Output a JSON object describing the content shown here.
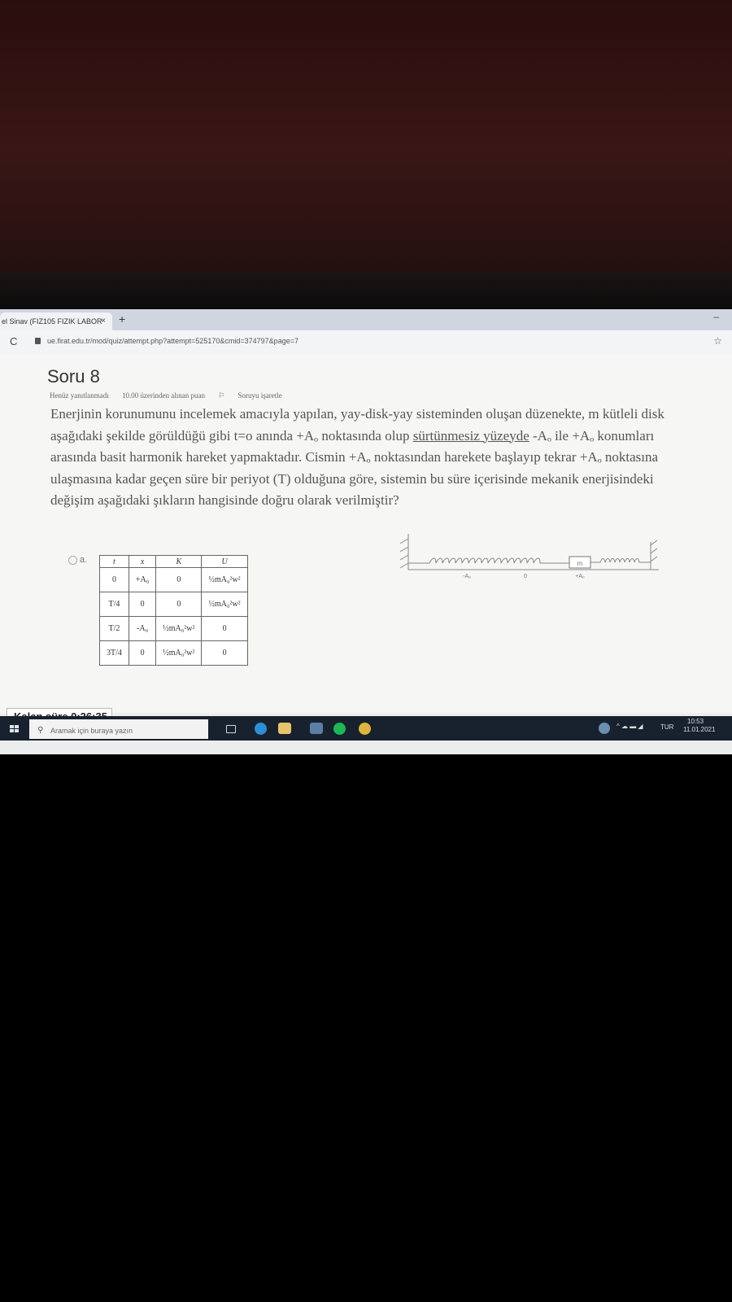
{
  "browser": {
    "tab_title": "el Sinav (FIZ105 FIZIK LABOR",
    "tab_close": "×",
    "new_tab": "+",
    "minimize": "–",
    "reload": "C",
    "url": "ue.firat.edu.tr/mod/quiz/attempt.php?attempt=525170&cmid=374797&page=7",
    "star": "☆"
  },
  "question": {
    "title": "Soru 8",
    "status": "Henüz yanıtlanmadı",
    "points": "10.00 üzerinden alınan puan",
    "flag": "Soruyu işaretle",
    "text_before": "Enerjinin korunumunu incelemek amacıyla yapılan, yay-disk-yay sisteminden oluşan düzenekte, m kütleli disk aşağıdaki şekilde görüldüğü gibi t=o anında +Aₒ noktasında olup ",
    "text_underlined": "sürtünmesiz yüzeyde",
    "text_after": " -Aₒ ile +Aₒ konumları arasında basit harmonik hareket yapmaktadır. Cismin +Aₒ noktasından harekete başlayıp tekrar +Aₒ noktasına ulaşmasına kadar geçen süre bir periyot (T) olduğuna göre, sistemin bu süre içerisinde mekanik enerjisindeki değişim aşağıdaki şıkların hangisinde doğru olarak verilmiştir?"
  },
  "option_a": {
    "label": "a.",
    "headers": [
      "t",
      "x",
      "K",
      "U"
    ],
    "rows": [
      [
        "0",
        "+A₀",
        "0",
        "½mA₀²w²"
      ],
      [
        "T/4",
        "0",
        "0",
        "½mA₀²w²"
      ],
      [
        "T/2",
        "-A₀",
        "½mA₀²w²",
        "0"
      ],
      [
        "3T/4",
        "0",
        "½mA₀²w²",
        "0"
      ]
    ]
  },
  "diagram": {
    "mass_label": "m",
    "labels": [
      "-Aₒ",
      "0",
      "+Aₒ"
    ]
  },
  "timer": {
    "label": "Kalan süre",
    "value": "0:26:35"
  },
  "taskbar": {
    "search_placeholder": "Aramak için buraya yazın",
    "language": "TUR",
    "time": "10:53",
    "date": "11.01.2021"
  }
}
